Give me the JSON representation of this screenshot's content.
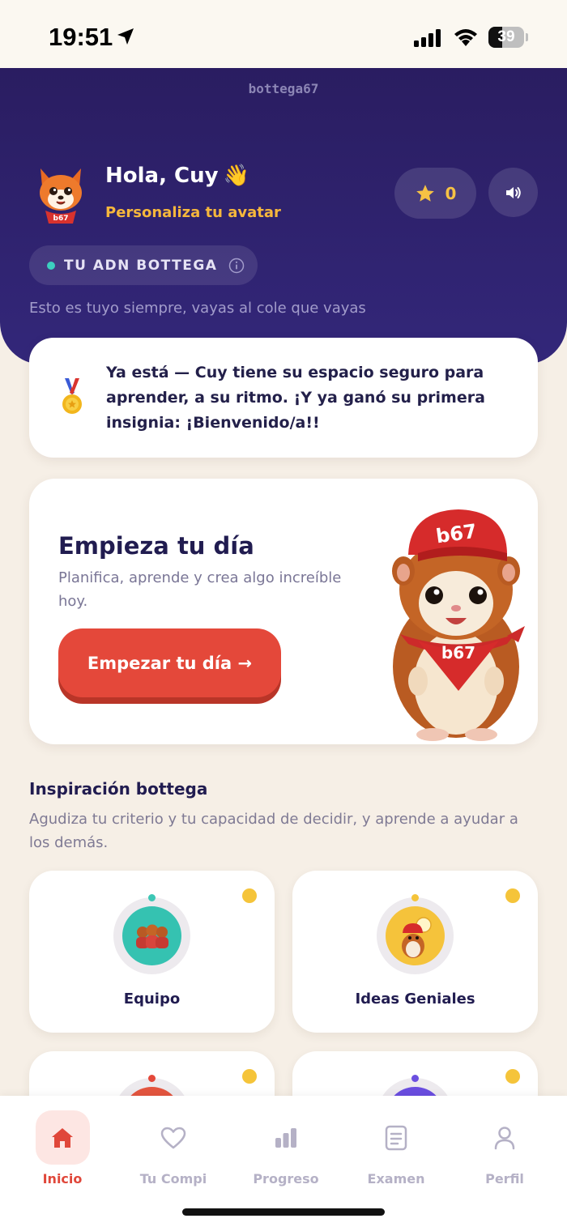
{
  "status_bar": {
    "time": "19:51",
    "battery": "39",
    "battery_level": 0.39
  },
  "header": {
    "brand": "bottega67",
    "greeting": "Hola, Cuy",
    "wave_emoji": "👋",
    "customize_link": "Personaliza tu avatar",
    "stars": "0",
    "adn_label": "TU ADN BOTTEGA",
    "adn_description": "Esto es tuyo siempre, vayas al cole que vayas"
  },
  "welcome_card": {
    "text": "Ya está — Cuy tiene su espacio seguro para aprender, a su ritmo. ¡Y ya ganó su primera insignia: ¡Bienvenido/a!!"
  },
  "day_card": {
    "title": "Empieza tu día",
    "subtitle": "Planifica, aprende y crea algo increíble hoy.",
    "button": "Empezar tu día →",
    "mascot_cap_text": "b67",
    "mascot_bandana_text": "b67"
  },
  "inspiration": {
    "title": "Inspiración bottega",
    "subtitle": "Agudiza tu criterio y tu capacidad de decidir, y aprende a ayudar a los demás.",
    "tiles": [
      {
        "label": "Equipo"
      },
      {
        "label": "Ideas Geniales"
      },
      {
        "label": ""
      },
      {
        "label": ""
      }
    ]
  },
  "tabs": [
    {
      "label": "Inicio",
      "icon": "home-icon",
      "active": true
    },
    {
      "label": "Tu Compi",
      "icon": "heart-icon",
      "active": false
    },
    {
      "label": "Progreso",
      "icon": "bar-chart-icon",
      "active": false
    },
    {
      "label": "Examen",
      "icon": "document-icon",
      "active": false
    },
    {
      "label": "Perfil",
      "icon": "user-icon",
      "active": false
    }
  ],
  "colors": {
    "header_bg": "#2a1d61",
    "accent_red": "#e4483a",
    "accent_yellow": "#f6b73c",
    "teal": "#3ccfbf",
    "page_bg": "#f6efe6"
  }
}
